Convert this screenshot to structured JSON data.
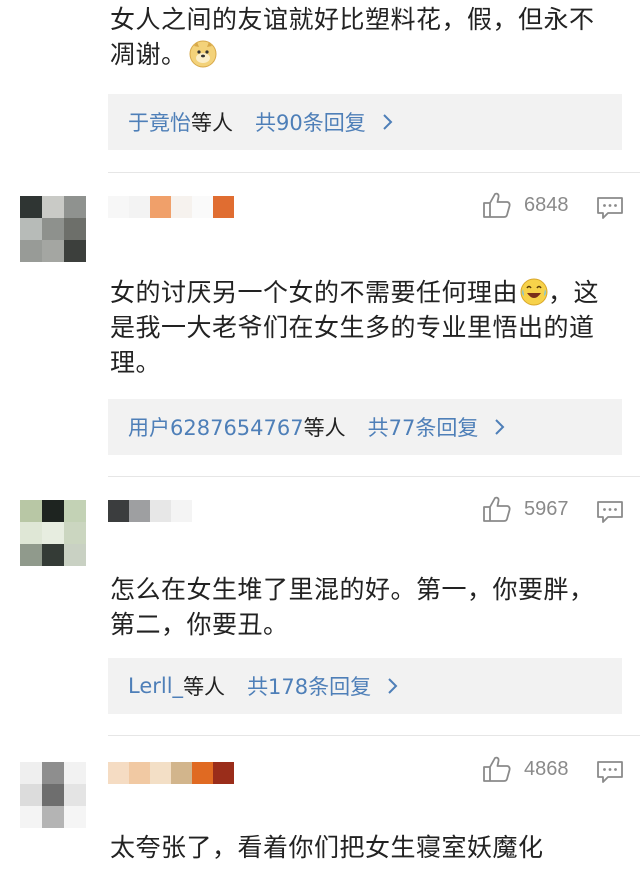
{
  "comments": [
    {
      "text_lines": [
        "女人之间的友谊就好比塑料花，假，但永不",
        "凋谢。"
      ],
      "emoji": "doge-emoji",
      "reply": {
        "names": "于竟怡",
        "names_suffix": "等人",
        "count": "共90条回复"
      }
    },
    {
      "likes": "6848",
      "text_lines": [
        "女的讨厌另一个女的不需要任何理由",
        "，这",
        "是我一大老爷们在女生多的专业里悟出的道",
        "理。"
      ],
      "emoji": "laughing-crying-emoji",
      "reply": {
        "names": "用户6287654767",
        "names_suffix": "等人",
        "count": "共77条回复"
      }
    },
    {
      "likes": "5967",
      "text_lines": [
        "怎么在女生堆了里混的好。第一，你要胖，",
        "第二，你要丑。"
      ],
      "reply": {
        "names": "Lerll_",
        "names_suffix": "等人",
        "count": "共178条回复"
      }
    },
    {
      "likes": "4868",
      "text_lines": [
        "太夸张了，看着你们把女生寝室妖魔化"
      ]
    }
  ],
  "icons": {
    "like": "thumbs-up-icon",
    "reply": "comment-icon",
    "chevron": "chevron-right-icon"
  },
  "colors": {
    "link": "#4e7fb8",
    "reply_bg": "#f2f2f2",
    "meta_gray": "#8a8a8a"
  }
}
